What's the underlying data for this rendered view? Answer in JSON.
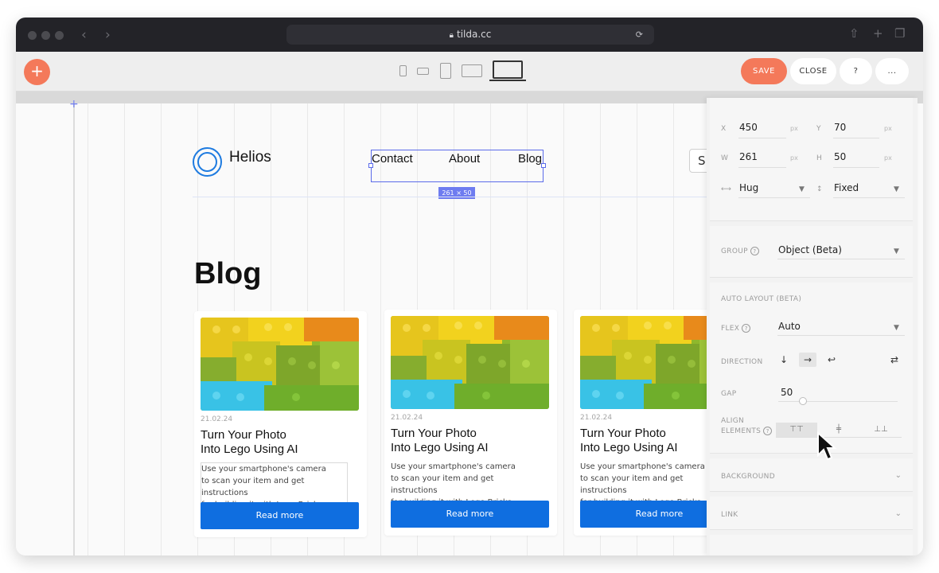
{
  "browser": {
    "url": "tilda.cc"
  },
  "toolbar": {
    "save_label": "SAVE",
    "close_label": "CLOSE",
    "help_label": "?",
    "more_label": "...",
    "add_label": "+"
  },
  "site": {
    "brand": "Helios",
    "nav": [
      "Contact",
      "About",
      "Blog"
    ],
    "search_stub": "S",
    "selection_dims": "261 × 50",
    "page_title": "Blog",
    "cards": [
      {
        "date": "21.02.24",
        "title_line1": "Turn Your Photo",
        "title_line2": "Into Lego Using AI",
        "desc_line1": "Use your smartphone's camera",
        "desc_line2": "to scan your item and get instructions",
        "desc_line3": "for building it with Lego Bricks.",
        "button": "Read more"
      },
      {
        "date": "21.02.24",
        "title_line1": "Turn Your Photo",
        "title_line2": "Into Lego Using AI",
        "desc_line1": "Use your smartphone's camera",
        "desc_line2": "to scan your item and get instructions",
        "desc_line3": "for building it with Lego Bricks.",
        "button": "Read more"
      },
      {
        "date": "21.02.24",
        "title_line1": "Turn Your Photo",
        "title_line2": "Into Lego Using AI",
        "desc_line1": "Use your smartphone's camera",
        "desc_line2": "to scan your item and get instructions",
        "desc_line3": "for building it with Lego Bricks.",
        "button": "Read more"
      }
    ]
  },
  "panel": {
    "x_label": "X",
    "x_value": "450",
    "x_unit": "px",
    "y_label": "Y",
    "y_value": "70",
    "y_unit": "px",
    "w_label": "W",
    "w_value": "261",
    "w_unit": "px",
    "h_label": "H",
    "h_value": "50",
    "h_unit": "px",
    "width_mode": "Hug",
    "height_mode": "Fixed",
    "group_label": "GROUP",
    "group_value": "Object (Beta)",
    "auto_layout_label": "AUTO LAYOUT (BETA)",
    "flex_label": "FLEX",
    "flex_value": "Auto",
    "direction_label": "DIRECTION",
    "gap_label": "GAP",
    "gap_value": "50",
    "align_label_line1": "ALIGN",
    "align_label_line2": "ELEMENTS",
    "background_label": "BACKGROUND",
    "link_label": "LINK",
    "help_glyph": "?"
  },
  "colors": {
    "accent": "#f4795a",
    "primary_button": "#0f6ee0",
    "selection": "#5b6bea",
    "logo": "#1e7be0"
  }
}
